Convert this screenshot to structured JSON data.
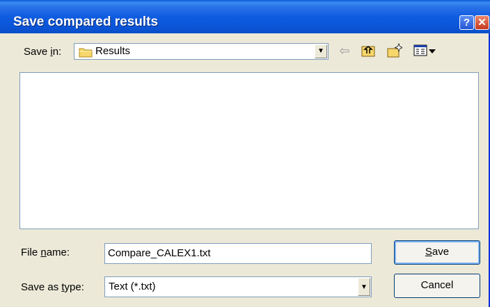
{
  "window": {
    "title": "Save compared results"
  },
  "titlebar": {
    "help_label": "?",
    "close_label": "✕"
  },
  "toolbar": {
    "save_in_label_pre": "Save ",
    "save_in_label_u": "i",
    "save_in_label_post": "n:",
    "folder": "Results",
    "icons": [
      "back-arrow-icon",
      "up-one-level-icon",
      "new-folder-icon",
      "view-menu-icon"
    ]
  },
  "file_name": {
    "label_pre": "File ",
    "label_u": "n",
    "label_post": "ame:",
    "value": "Compare_CALEX1.txt"
  },
  "save_as_type": {
    "label_pre": "Save as ",
    "label_u": "t",
    "label_post": "ype:",
    "value": "Text (*.txt)"
  },
  "buttons": {
    "save_u": "S",
    "save_rest": "ave",
    "cancel": "Cancel"
  },
  "colors": {
    "titlebar": "#0a5ad6",
    "dialog_bg": "#ece9d8",
    "border": "#7f9db9"
  }
}
